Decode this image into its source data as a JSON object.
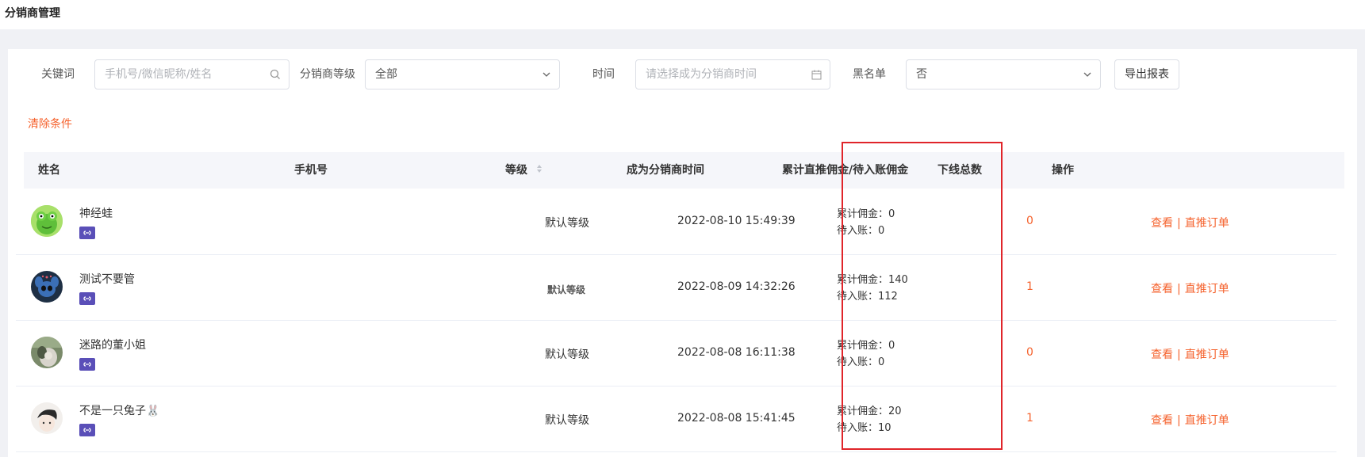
{
  "page": {
    "title": "分销商管理"
  },
  "filters": {
    "keyword_label": "关键词",
    "keyword_placeholder": "手机号/微信昵称/姓名",
    "level_label": "分销商等级",
    "level_value": "全部",
    "time_label": "时间",
    "time_placeholder": "请选择成为分销商时间",
    "blacklist_label": "黑名单",
    "blacklist_value": "否",
    "export_label": "导出报表",
    "clear_label": "清除条件"
  },
  "table": {
    "headers": {
      "name": "姓名",
      "phone": "手机号",
      "level": "等级",
      "time": "成为分销商时间",
      "commission": "累计直推佣金/待入账佣金",
      "downline": "下线总数",
      "ops": "操作"
    },
    "rows": [
      {
        "name": "神经蛙",
        "phone": "",
        "level": "默认等级",
        "time": "2022-08-10 15:49:39",
        "total": "累计佣金：0",
        "pending": "待入账：0",
        "downline": "0",
        "view": "查看",
        "orders": "直推订单"
      },
      {
        "name": "测试不要管",
        "phone": "",
        "level": "默认等级",
        "time": "2022-08-09 14:32:26",
        "total": "累计佣金：140",
        "pending": "待入账：112",
        "downline": "1",
        "view": "查看",
        "orders": "直推订单"
      },
      {
        "name": "迷路的董小姐",
        "phone": "",
        "level": "默认等级",
        "time": "2022-08-08 16:11:38",
        "total": "累计佣金：0",
        "pending": "待入账：0",
        "downline": "0",
        "view": "查看",
        "orders": "直推订单"
      },
      {
        "name": "不是一只兔子🐰",
        "phone": "",
        "level": "默认等级",
        "time": "2022-08-08 15:41:45",
        "total": "累计佣金：20",
        "pending": "待入账：10",
        "downline": "1",
        "view": "查看",
        "orders": "直推订单"
      }
    ],
    "op_separator": "|"
  },
  "colors": {
    "accent": "#f5622d",
    "highlight_border": "#e0252a",
    "badge": "#5a4fb8"
  }
}
